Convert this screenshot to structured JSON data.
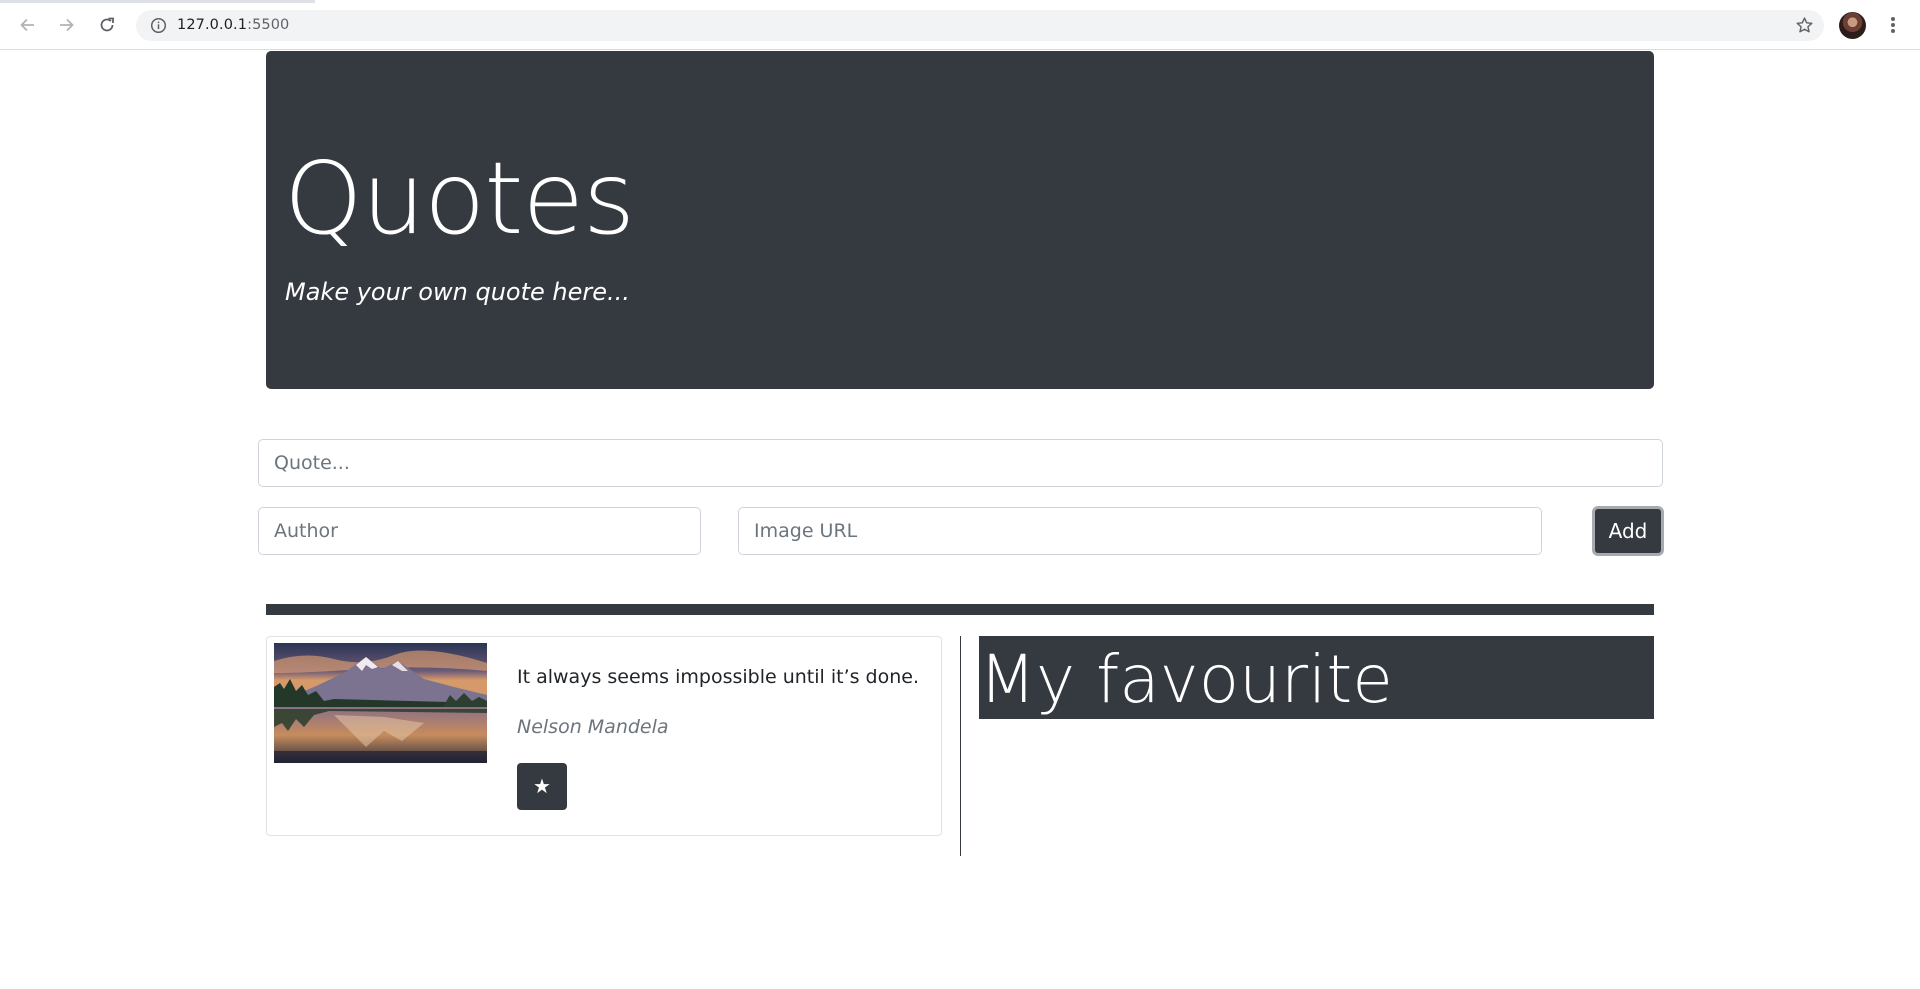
{
  "browser": {
    "url_host": "127.0.0.1",
    "url_port": ":5500",
    "icons": {
      "back": "arrow-left-icon",
      "forward": "arrow-right-icon",
      "reload": "reload-icon",
      "site_info": "info-icon",
      "bookmark": "star-outline-icon",
      "profile": "avatar",
      "menu": "kebab-menu-icon"
    }
  },
  "header": {
    "title": "Quotes",
    "subtitle": "Make your own quote here..."
  },
  "form": {
    "quote_placeholder": "Quote...",
    "author_placeholder": "Author",
    "image_url_placeholder": "Image URL",
    "add_label": "Add"
  },
  "quotes": [
    {
      "text": "It always seems impossible until it’s done.",
      "author": "Nelson Mandela",
      "favourite_label": "★"
    }
  ],
  "favourites": {
    "heading": "My favourite"
  },
  "colors": {
    "dark": "#343a40",
    "muted": "#6c757d",
    "border": "#ced4da"
  }
}
